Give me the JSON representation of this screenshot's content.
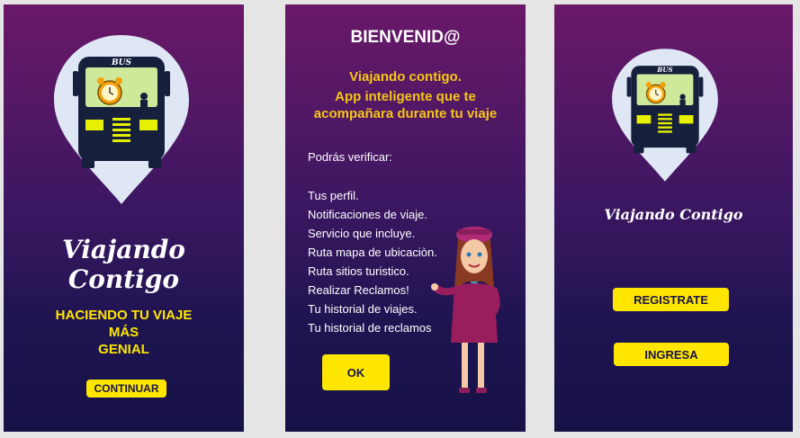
{
  "screen1": {
    "logo_bus_text": "BUS",
    "brand": "Viajando Contigo",
    "tagline": [
      "HACIENDO TU VIAJE",
      "MÁS",
      "GENIAL"
    ],
    "continue_label": "CONTINUAR"
  },
  "screen2": {
    "title": "BIENVENID@",
    "subtitle": [
      "Viajando contigo.",
      "App inteligente que te",
      "acompañara durante tu viaje"
    ],
    "verify_label": "Podrás verificar:",
    "items": [
      "Tus perfil.",
      "Notificaciones de viaje.",
      "Servicio que incluye.",
      "Ruta mapa de ubicaciòn.",
      "Ruta sitios turistico.",
      "Realizar Reclamos!",
      "Tu historial de viajes.",
      "Tu historial de reclamos"
    ],
    "ok_label": "OK"
  },
  "screen3": {
    "logo_bus_text": "BUS",
    "brand": "Viajando Contigo",
    "register_label": "REGISTRATE",
    "login_label": "INGRESA"
  },
  "colors": {
    "accent_yellow": "#ffe600",
    "gradient_top": "#6a1868",
    "gradient_bottom": "#161247",
    "pin_fill": "#dfe7f5",
    "bus_navy": "#16203d",
    "bus_window": "#cfe89a"
  }
}
